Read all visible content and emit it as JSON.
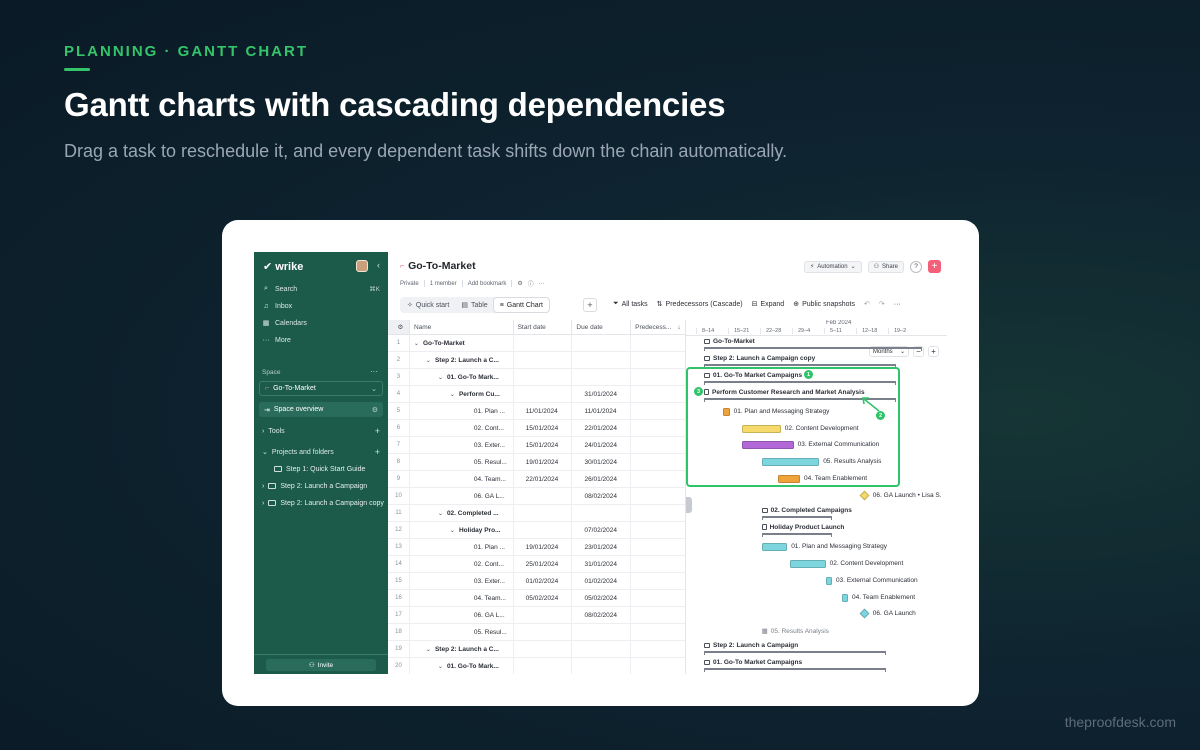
{
  "hero": {
    "eyebrow": "PLANNING · GANTT CHART",
    "headline": "Gantt charts with cascading dependencies",
    "subhead": "Drag a task to reschedule it, and every dependent task shifts down the chain automatically.",
    "site": "theproofdesk.com",
    "accent_color": "#34c46a"
  },
  "sidebar": {
    "brand": "wrike",
    "brand_icon": "checkmark-logo",
    "color": "#1c5a4a",
    "search_label": "Search",
    "search_shortcut": "⌘K",
    "inbox_label": "Inbox",
    "calendars_label": "Calendars",
    "more_label": "More",
    "space_label": "Space",
    "space_name": "Go-To-Market",
    "overview_label": "Space overview",
    "tools_label": "Tools",
    "projects_label": "Projects and folders",
    "folders": [
      "Step 1: Quick Start Guide",
      "Step 2: Launch a Campaign",
      "Step 2: Launch a Campaign copy"
    ],
    "invite_label": "Invite"
  },
  "header": {
    "title": "Go-To-Market",
    "privacy": "Private",
    "members": "1 member",
    "bookmark": "Add bookmark",
    "automation_label": "Automation",
    "share_label": "Share"
  },
  "tabs": [
    {
      "label": "Quick start",
      "icon": "spark-icon"
    },
    {
      "label": "Table",
      "icon": "table-icon"
    },
    {
      "label": "Gantt Chart",
      "icon": "gantt-icon",
      "active": true
    }
  ],
  "toolbar": {
    "all_tasks": "All tasks",
    "predecessors": "Predecessors (Cascade)",
    "expand": "Expand",
    "snapshots": "Public snapshots"
  },
  "table": {
    "columns": [
      "Name",
      "Start date",
      "Due date",
      "Predecess..."
    ],
    "rows": [
      {
        "num": "1",
        "name": "Go-To-Market",
        "start": "",
        "due": "",
        "indent": 0,
        "bold": true,
        "caret": true
      },
      {
        "num": "2",
        "name": "Step 2: Launch a C...",
        "start": "",
        "due": "",
        "indent": 1,
        "bold": true,
        "caret": true
      },
      {
        "num": "3",
        "name": "01. Go-To Mark...",
        "start": "",
        "due": "",
        "indent": 2,
        "bold": true,
        "caret": true
      },
      {
        "num": "4",
        "name": "Perform Cu...",
        "start": "",
        "due": "31/01/2024",
        "indent": 3,
        "bold": true,
        "caret": true
      },
      {
        "num": "5",
        "name": "01. Plan ...",
        "start": "11/01/2024",
        "due": "11/01/2024",
        "indent": 4
      },
      {
        "num": "6",
        "name": "02. Cont...",
        "start": "15/01/2024",
        "due": "22/01/2024",
        "indent": 4
      },
      {
        "num": "7",
        "name": "03. Exter...",
        "start": "15/01/2024",
        "due": "24/01/2024",
        "indent": 4
      },
      {
        "num": "8",
        "name": "05. Resul...",
        "start": "19/01/2024",
        "due": "30/01/2024",
        "indent": 4
      },
      {
        "num": "9",
        "name": "04. Team...",
        "start": "22/01/2024",
        "due": "26/01/2024",
        "indent": 4
      },
      {
        "num": "10",
        "name": "06. GA L...",
        "start": "",
        "due": "08/02/2024",
        "indent": 4
      },
      {
        "num": "11",
        "name": "02. Completed ...",
        "start": "",
        "due": "",
        "indent": 2,
        "bold": true,
        "caret": true
      },
      {
        "num": "12",
        "name": "Holiday Pro...",
        "start": "",
        "due": "07/02/2024",
        "indent": 3,
        "bold": true,
        "caret": true
      },
      {
        "num": "13",
        "name": "01. Plan ...",
        "start": "19/01/2024",
        "due": "23/01/2024",
        "indent": 4
      },
      {
        "num": "14",
        "name": "02. Cont...",
        "start": "25/01/2024",
        "due": "31/01/2024",
        "indent": 4
      },
      {
        "num": "15",
        "name": "03. Exter...",
        "start": "01/02/2024",
        "due": "01/02/2024",
        "indent": 4
      },
      {
        "num": "16",
        "name": "04. Team...",
        "start": "05/02/2024",
        "due": "05/02/2024",
        "indent": 4
      },
      {
        "num": "17",
        "name": "06. GA L...",
        "start": "",
        "due": "08/02/2024",
        "indent": 4
      },
      {
        "num": "18",
        "name": "05. Resul...",
        "start": "",
        "due": "",
        "indent": 4
      },
      {
        "num": "19",
        "name": "Step 2: Launch a C...",
        "start": "",
        "due": "",
        "indent": 1,
        "bold": true,
        "caret": true
      },
      {
        "num": "20",
        "name": "01. Go-To Mark...",
        "start": "",
        "due": "",
        "indent": 2,
        "bold": true,
        "caret": true
      }
    ]
  },
  "gantt": {
    "month": "Feb 2024",
    "weeks": [
      "8–14",
      "15–21",
      "22–28",
      "29–4",
      "5–11",
      "12–18",
      "19–2"
    ],
    "zoom_label": "Months",
    "badges": [
      "1",
      "2",
      "3"
    ],
    "items": [
      {
        "label": "Go-To-Market",
        "type": "summary",
        "start": 0.0,
        "end": 6.8
      },
      {
        "label": "Step 2: Launch a Campaign copy",
        "type": "summary",
        "start": 0.0,
        "end": 6.0
      },
      {
        "label": "01. Go-To Market Campaigns",
        "type": "summary",
        "start": 0.0,
        "end": 6.0
      },
      {
        "label": "Perform Customer Research and Market Analysis",
        "type": "summary",
        "start": 0.0,
        "end": 6.0
      },
      {
        "label": "01. Plan and Messaging Strategy",
        "type": "bar",
        "start": 0.6,
        "end": 0.8,
        "color": "#f0a23b"
      },
      {
        "label": "02. Content Development",
        "type": "bar",
        "start": 1.2,
        "end": 2.4,
        "color": "#f5d96b"
      },
      {
        "label": "03. External Communication",
        "type": "bar",
        "start": 1.2,
        "end": 2.8,
        "color": "#b268d6"
      },
      {
        "label": "05. Results Analysis",
        "type": "bar",
        "start": 1.8,
        "end": 3.6,
        "color": "#7dd6de"
      },
      {
        "label": "04. Team Enablement",
        "type": "bar",
        "start": 2.3,
        "end": 3.0,
        "color": "#f0a23b"
      },
      {
        "label": "06. GA Launch • Lisa S.",
        "type": "milestone",
        "start": 4.9,
        "color": "#f5d96b"
      },
      {
        "label": "02. Completed Campaigns",
        "type": "summary",
        "start": 1.8,
        "end": 4.0
      },
      {
        "label": "Holiday Product Launch",
        "type": "summary",
        "start": 1.8,
        "end": 4.0
      },
      {
        "label": "01. Plan and Messaging Strategy",
        "type": "bar",
        "start": 1.8,
        "end": 2.6,
        "color": "#7dd6de"
      },
      {
        "label": "02. Content Development",
        "type": "bar",
        "start": 2.7,
        "end": 3.8,
        "color": "#7dd6de"
      },
      {
        "label": "03. External Communication",
        "type": "bar",
        "start": 3.8,
        "end": 4.0,
        "color": "#7dd6de"
      },
      {
        "label": "04. Team Enablement",
        "type": "bar",
        "start": 4.3,
        "end": 4.5,
        "color": "#7dd6de"
      },
      {
        "label": "06. GA Launch",
        "type": "milestone",
        "start": 4.9,
        "color": "#7dd6de"
      },
      {
        "label": "05. Results Analysis",
        "type": "unscheduled",
        "start": 1.8
      },
      {
        "label": "Step 2: Launch a Campaign",
        "type": "summary",
        "start": 0.0,
        "end": 5.7
      },
      {
        "label": "01. Go-To Market Campaigns",
        "type": "summary",
        "start": 0.0,
        "end": 5.7
      }
    ]
  }
}
